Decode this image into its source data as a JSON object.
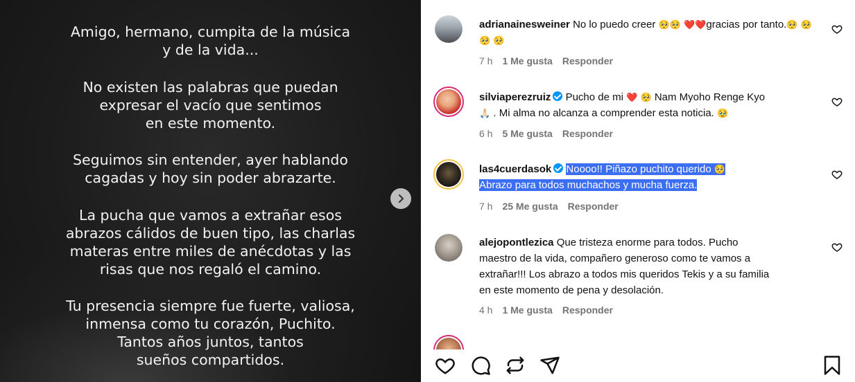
{
  "post_image": {
    "paragraph1": "Amigo, hermano, cumpita de la música\ny de la vida...",
    "paragraph2": "No existen las palabras que puedan\nexpresar el vacío que sentimos\nen este momento.",
    "paragraph3": "Seguimos sin entender, ayer hablando\ncagadas y hoy sin poder abrazarte.",
    "paragraph4": "La pucha que vamos a extrañar esos\nabrazos cálidos de buen tipo, las charlas\nmateras entre miles de anécdotas y las\nrisas que nos regaló el camino.",
    "paragraph5": "Tu presencia siempre fue fuerte, valiosa,\ninmensa como tu corazón, Puchito.\nTantos años juntos, tantos\nsueños compartidos."
  },
  "comments": [
    {
      "username": "adrianainesweiner",
      "text_a": "No lo puedo creer",
      "text_b": "gracias por",
      "text_c": "tanto.",
      "time": "7 h",
      "likes": "1 Me gusta",
      "reply": "Responder"
    },
    {
      "username": "silviaperezruiz",
      "text_a": "Pucho de mi",
      "text_b": "Nam Myoho Renge Kyo",
      "text_c": ". Mi alma no alcanza a comprender esta noticia.",
      "time": "6 h",
      "likes": "5 Me gusta",
      "reply": "Responder"
    },
    {
      "username": "las4cuerdasok",
      "text_a": "Noooo!! Piñazo puchito querido",
      "text_b": "Abrazo para todos muchachos y mucha fuerza.",
      "time": "7 h",
      "likes": "25 Me gusta",
      "reply": "Responder"
    },
    {
      "username": "alejopontlezica",
      "text_a": "Que tristeza enorme para todos. Pucho",
      "text_b": "maestro de la vida, compañero generoso como te vamos a",
      "text_c": "extrañar!!! Los abrazo a todos mis queridos Tekis y a su familia",
      "text_d": "en este momento de pena y desolación.",
      "time": "4 h",
      "likes": "1 Me gusta",
      "reply": "Responder"
    }
  ],
  "emoji": {
    "sad": "🥺",
    "heart": "❤️",
    "pray": "🙏🏻",
    "cry": "🥹"
  },
  "colors": {
    "highlight": "#3b6ef0",
    "verified": "#0095f6",
    "muted": "#737373"
  }
}
